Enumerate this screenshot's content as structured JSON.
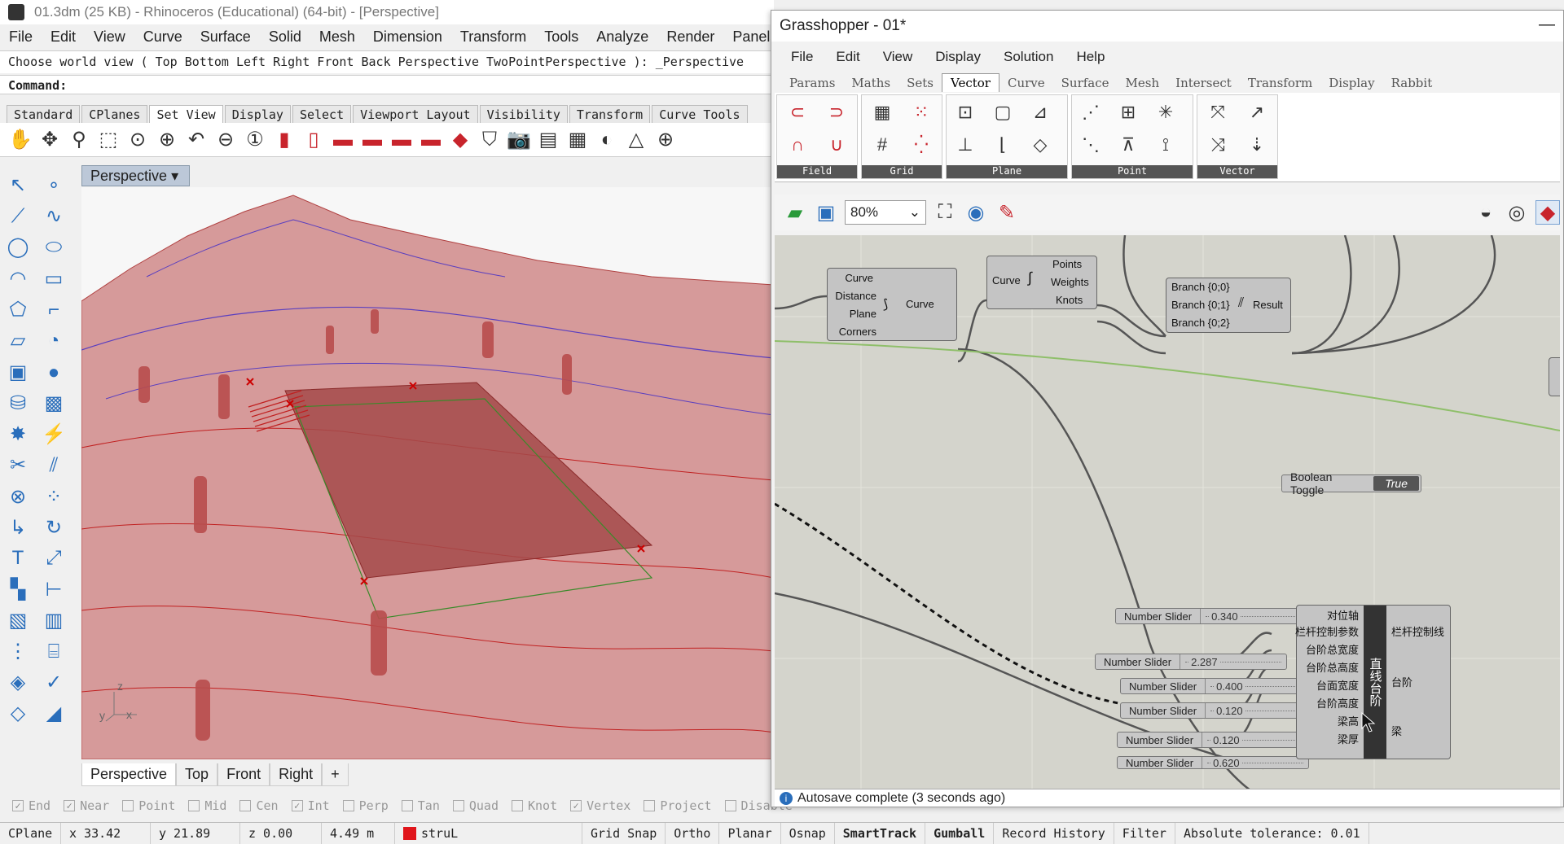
{
  "rhino": {
    "title": "01.3dm (25 KB) - Rhinoceros (Educational) (64-bit) - [Perspective]",
    "menu": [
      "File",
      "Edit",
      "View",
      "Curve",
      "Surface",
      "Solid",
      "Mesh",
      "Dimension",
      "Transform",
      "Tools",
      "Analyze",
      "Render",
      "Panels"
    ],
    "command_history": "Choose world view ( Top  Bottom  Left  Right  Front  Back  Perspective  TwoPointPerspective ): _Perspective",
    "command_prompt": "Command:",
    "toolbar_tabs": [
      "Standard",
      "CPlanes",
      "Set View",
      "Display",
      "Select",
      "Viewport Layout",
      "Visibility",
      "Transform",
      "Curve Tools"
    ],
    "active_toolbar_tab": "Set View",
    "viewport_title": "Perspective",
    "viewport_tabs": [
      "Perspective",
      "Top",
      "Front",
      "Right"
    ],
    "add_tab": "+",
    "axis_labels": {
      "x": "x",
      "y": "y",
      "z": "z"
    },
    "osnaps": [
      {
        "label": "End",
        "checked": true
      },
      {
        "label": "Near",
        "checked": true
      },
      {
        "label": "Point",
        "checked": false
      },
      {
        "label": "Mid",
        "checked": false
      },
      {
        "label": "Cen",
        "checked": false
      },
      {
        "label": "Int",
        "checked": true
      },
      {
        "label": "Perp",
        "checked": false
      },
      {
        "label": "Tan",
        "checked": false
      },
      {
        "label": "Quad",
        "checked": false
      },
      {
        "label": "Knot",
        "checked": false
      },
      {
        "label": "Vertex",
        "checked": true
      },
      {
        "label": "Project",
        "checked": false
      },
      {
        "label": "Disable",
        "checked": false
      }
    ],
    "status": {
      "cplane": "CPlane",
      "x": "x 33.42",
      "y": "y 21.89",
      "z": "z 0.00",
      "units": "4.49 m",
      "layer": "struL",
      "layer_color": "#e0151b",
      "grid_snap": "Grid Snap",
      "ortho": "Ortho",
      "planar": "Planar",
      "osnap": "Osnap",
      "smarttrack": "SmartTrack",
      "gumball": "Gumball",
      "record_history": "Record History",
      "filter": "Filter",
      "tolerance": "Absolute tolerance: 0.01"
    }
  },
  "grasshopper": {
    "title": "Grasshopper - 01*",
    "minimize": "—",
    "menu": [
      "File",
      "Edit",
      "View",
      "Display",
      "Solution",
      "Help"
    ],
    "tabs": [
      "Params",
      "Maths",
      "Sets",
      "Vector",
      "Curve",
      "Surface",
      "Mesh",
      "Intersect",
      "Transform",
      "Display",
      "Rabbit"
    ],
    "active_tab": "Vector",
    "ribbon_groups": [
      "Field",
      "Grid",
      "Plane",
      "Point",
      "Vector"
    ],
    "zoom": "80%",
    "status": "Autosave complete (3 seconds ago)",
    "nodes": {
      "divide": {
        "inputs": [
          "Curve",
          "Distance",
          "Plane",
          "Corners"
        ],
        "output": "Curve"
      },
      "ctrlpts": {
        "input": "Curve",
        "outputs": [
          "Points",
          "Weights",
          "Knots"
        ]
      },
      "entwine": {
        "inputs": [
          "Branch {0;0}",
          "Branch {0;1}",
          "Branch {0;2}"
        ],
        "output": "Result"
      },
      "toggle": {
        "name": "Boolean Toggle",
        "value": "True"
      },
      "cluster": {
        "name": "直线台阶",
        "inputs": [
          "对位轴",
          "栏杆控制参数",
          "台阶总宽度",
          "台阶总高度",
          "台面宽度",
          "台阶高度",
          "梁高",
          "梁厚"
        ],
        "outputs": [
          "栏杆控制线",
          "台阶",
          "梁"
        ]
      }
    },
    "sliders": [
      {
        "name": "Number Slider",
        "value": "0.340"
      },
      {
        "name": "Number Slider",
        "value": "2.287"
      },
      {
        "name": "Number Slider",
        "value": "0.400"
      },
      {
        "name": "Number Slider",
        "value": "0.120"
      },
      {
        "name": "Number Slider",
        "value": "0.120"
      },
      {
        "name": "Number Slider",
        "value": "0.620"
      }
    ]
  }
}
